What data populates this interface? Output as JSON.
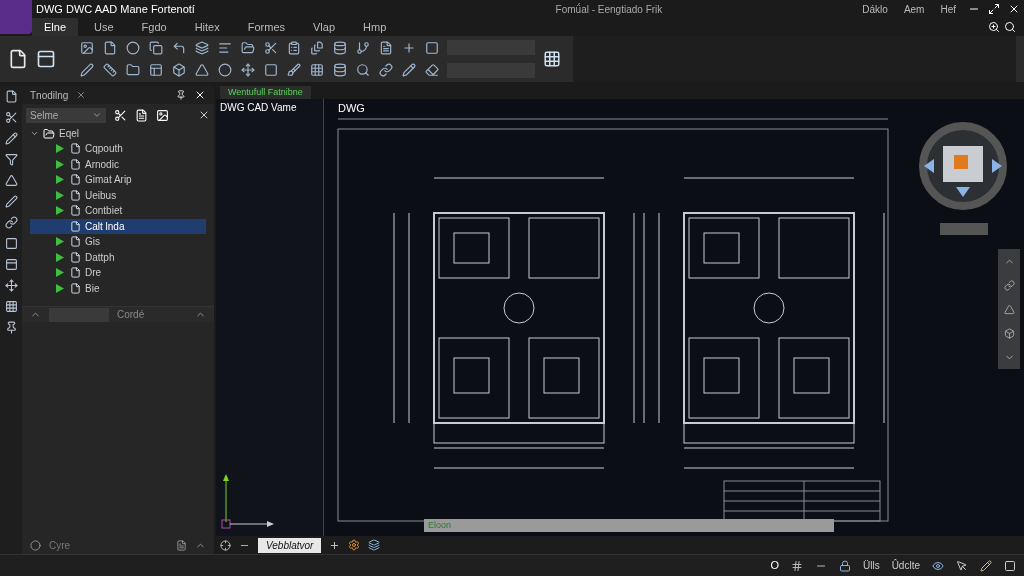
{
  "title_bar": {
    "app_title": "DWG DWC AAD Mane Fortenotí",
    "document_title": "Fomǘal - Eengtiado Frik",
    "actions": [
      {
        "label": "Dáklo"
      },
      {
        "label": "Aem"
      },
      {
        "label": "Hef"
      }
    ]
  },
  "menu": [
    {
      "label": "Elne",
      "selected": true
    },
    {
      "label": "Use",
      "selected": false
    },
    {
      "label": "Fgdo",
      "selected": false
    },
    {
      "label": "Hitex",
      "selected": false
    },
    {
      "label": "Formes",
      "selected": false
    },
    {
      "label": "Vlap",
      "selected": false
    },
    {
      "label": "Hmp",
      "selected": false
    }
  ],
  "left_panel": {
    "title": "Tnodilng",
    "filter": {
      "value": "Selme"
    },
    "tree": {
      "label": "Eqel",
      "expanded": true,
      "children": [
        {
          "label": "Cqpouth",
          "has_children": true,
          "selected": false
        },
        {
          "label": "Arnodic",
          "has_children": true,
          "selected": false
        },
        {
          "label": "Gimat Arip",
          "has_children": true,
          "selected": false
        },
        {
          "label": "Ueibus",
          "has_children": true,
          "selected": false
        },
        {
          "label": "Contbiet",
          "has_children": true,
          "selected": false
        },
        {
          "label": "Calt lnda",
          "has_children": false,
          "selected": true
        },
        {
          "label": "Gis",
          "has_children": true,
          "selected": false
        },
        {
          "label": "Dattph",
          "has_children": true,
          "selected": false
        },
        {
          "label": "Dre",
          "has_children": true,
          "selected": false
        },
        {
          "label": "Bie",
          "has_children": true,
          "selected": false
        }
      ]
    },
    "section_label": "Cordé",
    "footer_label": "Cyre"
  },
  "document_tab": {
    "label": "Wentufull Fatnibne"
  },
  "side_viewport": {
    "title": "DWG CAD Vame"
  },
  "main_viewport": {
    "label": "DWG",
    "command_text": "Eloon"
  },
  "layout_tabs": [
    {
      "label": "Vebblatvor",
      "selected": true
    }
  ],
  "status_bar": {
    "coordinate": "O",
    "items": [
      {
        "label": "Ülls"
      },
      {
        "label": "Ûdclte"
      }
    ]
  }
}
